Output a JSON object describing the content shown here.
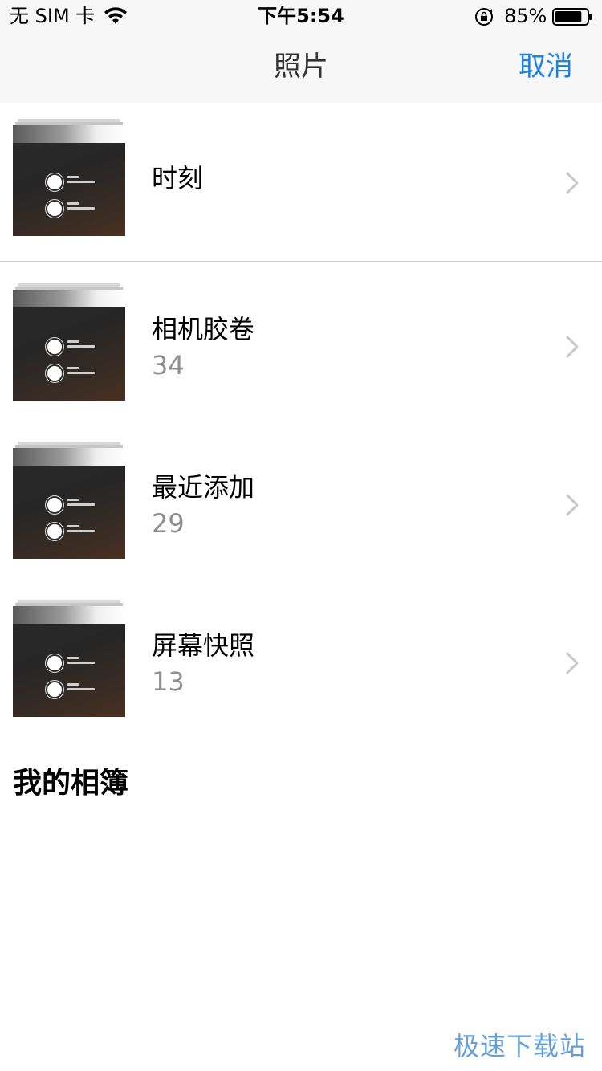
{
  "status_bar": {
    "carrier": "无 SIM 卡",
    "time": "下午5:54",
    "battery_percent": "85%",
    "battery_level": 0.85,
    "icons": [
      "wifi-icon",
      "rotation-lock-icon",
      "battery-icon"
    ]
  },
  "nav": {
    "title": "照片",
    "cancel_label": "取消",
    "accent_color": "#1a82e2"
  },
  "albums": [
    {
      "name": "时刻",
      "count": ""
    },
    {
      "name": "相机胶卷",
      "count": "34"
    },
    {
      "name": "最近添加",
      "count": "29"
    },
    {
      "name": "屏幕快照",
      "count": "13"
    }
  ],
  "section": {
    "my_albums_label": "我的相簿"
  },
  "watermark": "极速下载站"
}
